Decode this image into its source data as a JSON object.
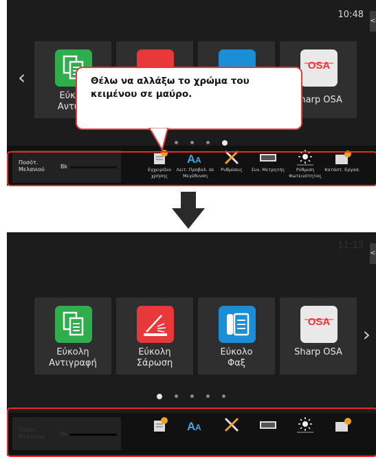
{
  "top_screen": {
    "time": "10:48",
    "side_tab": "<",
    "tiles": [
      {
        "label": "Εύκολ\nΑντιγρ",
        "icon": "copy-icon"
      },
      {
        "label": "",
        "icon": "scan-icon"
      },
      {
        "label": "",
        "icon": "fax-icon"
      },
      {
        "label": "Sharp OSA",
        "icon": "osa-icon"
      }
    ],
    "left_arrow": "‹",
    "callout": "Θέλω να αλλάξω το χρώμα του κειμένου σε μαύρο.",
    "toner": {
      "label": "Ποσότ. Μελανιού",
      "channel": "Bk"
    },
    "bar_items": [
      {
        "label": "Εγχειρίδιο χρήσης",
        "icon": "manual-icon"
      },
      {
        "label": "Λειτ. Προβολ. σε Μεγέθυνση",
        "icon": "magnify-text-icon"
      },
      {
        "label": "Ρυθμίσεις",
        "icon": "settings-tools-icon"
      },
      {
        "label": "Συν. Μετρητής",
        "icon": "counter-icon"
      },
      {
        "label": "Ρύθμιση Φωτεινότητας",
        "icon": "brightness-icon"
      },
      {
        "label": "Κατάστ. Εργασ.",
        "icon": "job-status-icon"
      }
    ],
    "page_dots": 4,
    "active_dot": 3
  },
  "bottom_screen": {
    "time": "11:13",
    "side_tab": "<",
    "tiles": [
      {
        "label": "Εύκολη\nΑντιγραφή",
        "icon": "copy-icon"
      },
      {
        "label": "Εύκολη\nΣάρωση",
        "icon": "scan-icon"
      },
      {
        "label": "Εύκολο\nΦαξ",
        "icon": "fax-icon"
      },
      {
        "label": "Sharp OSA",
        "icon": "osa-icon"
      }
    ],
    "right_arrow": "›",
    "toner": {
      "label": "Ποσότ. Μελανιού",
      "channel": "Bk"
    },
    "page_dots": 5,
    "active_dot": 0
  },
  "colors": {
    "screen_bg": "#1c1c1c",
    "highlight": "#ee2a2a",
    "copy_green": "#2fae4e",
    "scan_red": "#e8383a",
    "fax_blue": "#1a8fd8"
  }
}
